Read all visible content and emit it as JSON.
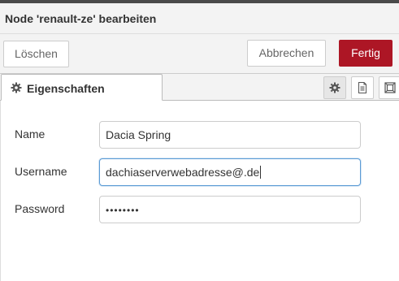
{
  "header": {
    "title": "Node 'renault-ze' bearbeiten"
  },
  "toolbar": {
    "delete_label": "Löschen",
    "cancel_label": "Abbrechen",
    "done_label": "Fertig",
    "done_color": "#ad1625"
  },
  "tabs": {
    "active_label": "Eigenschaften",
    "active_icon": "gear-icon",
    "side_icons": [
      "gear-icon",
      "document-icon",
      "frame-icon"
    ],
    "selected_side_icon": "gear-icon"
  },
  "form": {
    "name_label": "Name",
    "name_value": "Dacia Spring",
    "username_label": "Username",
    "username_value": "dachiaserverwebadresse@.de",
    "password_label": "Password",
    "password_value": "••••••••"
  }
}
